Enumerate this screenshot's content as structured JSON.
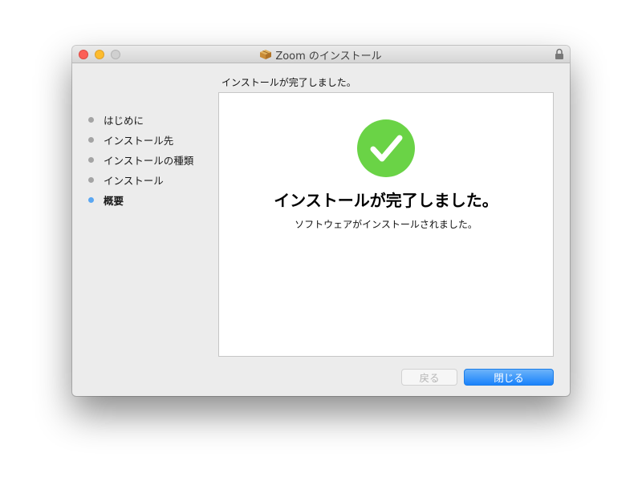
{
  "window": {
    "title": "Zoom のインストール"
  },
  "header": {
    "text": "インストールが完了しました。"
  },
  "sidebar": {
    "steps": [
      {
        "label": "はじめに"
      },
      {
        "label": "インストール先"
      },
      {
        "label": "インストールの種類"
      },
      {
        "label": "インストール"
      },
      {
        "label": "概要",
        "current": true
      }
    ]
  },
  "main": {
    "headline": "インストールが完了しました。",
    "subtext": "ソフトウェアがインストールされました。"
  },
  "buttons": {
    "back_label": "戻る",
    "close_label": "閉じる"
  },
  "colors": {
    "success_green": "#6ad346",
    "primary_blue": "#1a82fb",
    "current_step_dot": "#5aa7f2"
  },
  "icons": {
    "title": "package-icon",
    "lock": "lock-icon",
    "success": "checkmark-circle-icon"
  }
}
